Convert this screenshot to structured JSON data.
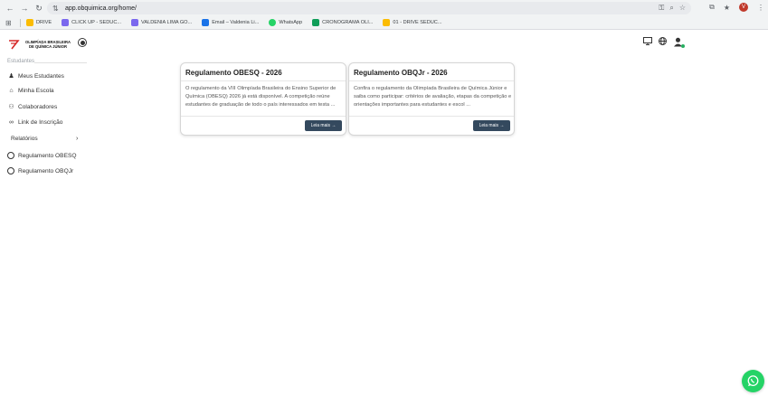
{
  "browser": {
    "url": "app.obquimica.org/home/",
    "profile_initial": "V",
    "bookmarks": [
      {
        "label": "DRIVE",
        "color": "#fbbc04"
      },
      {
        "label": "CLICK UP - SEDUC...",
        "color": "#7b68ee"
      },
      {
        "label": "VALDENIA LIMA GO...",
        "color": "#7b68ee"
      },
      {
        "label": "Email – Valdenia Li...",
        "color": "#1a73e8"
      },
      {
        "label": "WhatsApp",
        "color": "#25d366"
      },
      {
        "label": "CRONOGRAMA OLI...",
        "color": "#0f9d58"
      },
      {
        "label": "01 - DRIVE SEDUC...",
        "color": "#fbbc04"
      }
    ]
  },
  "header": {
    "logo_line1": "OLIMPÍADA BRASILEIRA",
    "logo_line2": "DE QUÍMICA JÚNIOR"
  },
  "sidebar": {
    "section_title": "Estudantes",
    "items": [
      {
        "label": "Meus Estudantes",
        "icon": "graduate-icon"
      },
      {
        "label": "Minha Escola",
        "icon": "school-icon"
      },
      {
        "label": "Colaboradores",
        "icon": "users-icon"
      },
      {
        "label": "Link de Inscrição",
        "icon": "link-icon"
      }
    ],
    "reports_label": "Relatórios",
    "sub_items": [
      {
        "label": "Regulamento OBESQ"
      },
      {
        "label": "Regulamento OBQJr"
      }
    ]
  },
  "cards": [
    {
      "title": "Regulamento OBESQ - 2026",
      "body": "O regulamento da VIII Olimpíada Brasileira do Ensino Superior de Química (OBESQ) 2026 já está disponível. A competição reúne estudantes de graduação de todo o país interessados em testa ...",
      "button": "Leia mais →"
    },
    {
      "title": "Regulamento OBQJr - 2026",
      "body": "Confira o regulamento da Olimpíada Brasileira de Química Júnior e saiba como participar: critérios de avaliação, etapas da competição e orientações importantes para estudantes e escol ...",
      "button": "Leia mais →"
    }
  ],
  "colors": {
    "button_bg": "#34495e",
    "whatsapp": "#25d366",
    "online": "#27ae60"
  }
}
